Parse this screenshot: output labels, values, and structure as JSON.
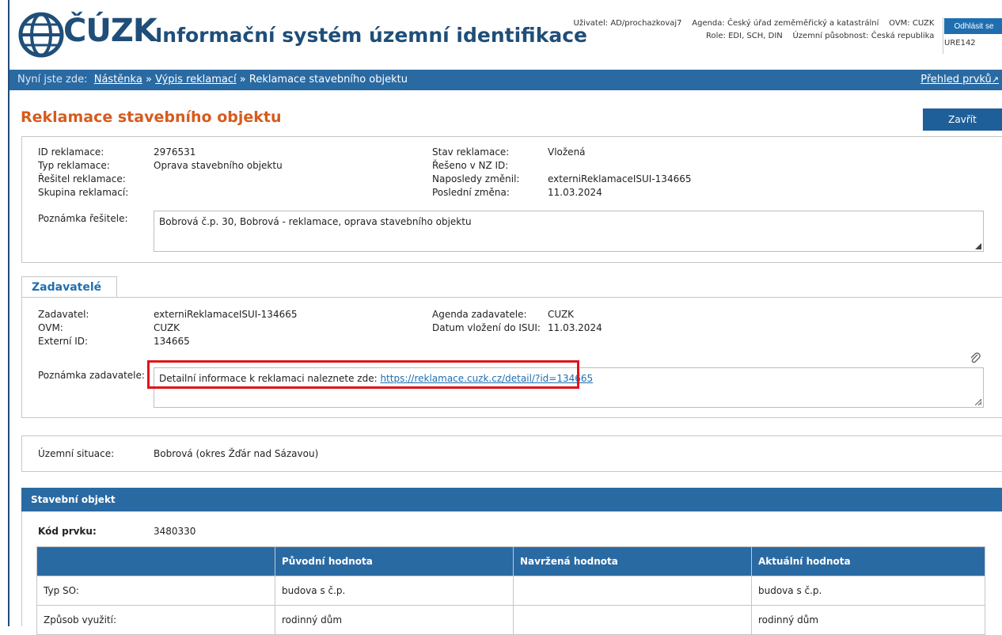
{
  "header": {
    "logo_text": "ČÚZK",
    "app_title": "Informační systém územní identifikace",
    "user_line1": "Uživatel: AD/prochazkovaj7    Agenda: Český úřad zeměměřický a katastrální    OVM: CUZK",
    "user_line2": "Role: EDI, SCH, DIN    Územní působnost: Česká republika",
    "logout_label": "Odhlásit se",
    "ure": "URE142"
  },
  "navbar": {
    "location_label": "Nyní jste zde:",
    "crumbs": [
      "Nástěnka",
      "Výpis reklamací",
      "Reklamace stavebního objektu"
    ],
    "separator": "»",
    "overview_link": "Přehled prvků"
  },
  "page": {
    "title": "Reklamace stavebního objektu",
    "close_label": "Zavřít"
  },
  "claim": {
    "id_label": "ID reklamace:",
    "id_value": "2976531",
    "type_label": "Typ reklamace:",
    "type_value": "Oprava stavebního objektu",
    "solver_label": "Řešitel reklamace:",
    "solver_value": "",
    "group_label": "Skupina reklamací:",
    "group_value": "",
    "state_label": "Stav reklamace:",
    "state_value": "Vložená",
    "nz_label": "Řešeno v NZ ID:",
    "nz_value": "",
    "changed_by_label": "Naposledy změnil:",
    "changed_by_value": "externiReklamaceISUI-134665",
    "last_change_label": "Poslední změna:",
    "last_change_value": "11.03.2024",
    "note_label": "Poznámka řešitele:",
    "note_value": "Bobrová č.p. 30, Bobrová - reklamace, oprava stavebního objektu"
  },
  "submitters": {
    "tab_label": "Zadavatelé",
    "submitter_label": "Zadavatel:",
    "submitter_value": "externiReklamaceISUI-134665",
    "ovm_label": "OVM:",
    "ovm_value": "CUZK",
    "ext_id_label": "Externí ID:",
    "ext_id_value": "134665",
    "agenda_label": "Agenda zadavatele:",
    "agenda_value": "CUZK",
    "date_label": "Datum vložení do ISUI:",
    "date_value": "11.03.2024",
    "note_label": "Poznámka zadavatele:",
    "note_text": "Detailní informace k reklamaci naleznete zde: ",
    "note_link": "https://reklamace.cuzk.cz/detail/?id=134665"
  },
  "territory": {
    "label": "Územní situace:",
    "value": "Bobrová (okres Žďár nad Sázavou)"
  },
  "building": {
    "header": "Stavební objekt",
    "code_label": "Kód prvku:",
    "code_value": "3480330",
    "columns": [
      "",
      "Původní hodnota",
      "Navržená hodnota",
      "Aktuální hodnota"
    ],
    "rows": [
      [
        "Typ SO:",
        "budova s č.p.",
        "",
        "budova s č.p."
      ],
      [
        "Způsob využití:",
        "rodinný dům",
        "",
        "rodinný dům"
      ]
    ]
  },
  "colors": {
    "brand_blue": "#1f4e79",
    "bar_blue": "#2a6aa3",
    "title_orange": "#d65b1e",
    "highlight_red": "#e0141a"
  }
}
